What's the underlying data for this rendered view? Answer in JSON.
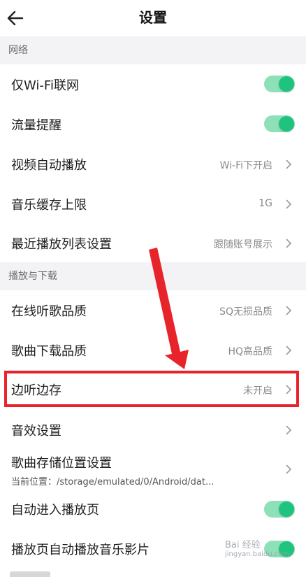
{
  "header": {
    "title": "设置",
    "back_icon": "arrow-left-icon"
  },
  "sections": [
    {
      "title": "网络",
      "items": [
        {
          "label": "仅Wi-Fi联网",
          "control": "toggle",
          "on": true
        },
        {
          "label": "流量提醒",
          "control": "toggle",
          "on": true
        },
        {
          "label": "视频自动播放",
          "value": "Wi-Fi下开启",
          "control": "chevron"
        },
        {
          "label": "音乐缓存上限",
          "value": "1G",
          "control": "chevron"
        },
        {
          "label": "最近播放列表设置",
          "value": "跟随账号展示",
          "control": "chevron"
        }
      ]
    },
    {
      "title": "播放与下载",
      "items": [
        {
          "label": "在线听歌品质",
          "value": "SQ无损品质",
          "control": "chevron"
        },
        {
          "label": "歌曲下载品质",
          "value": "HQ高品质",
          "control": "chevron"
        },
        {
          "label": "边听边存",
          "value": "未开启",
          "control": "chevron"
        },
        {
          "label": "音效设置",
          "control": "chevron"
        },
        {
          "label": "歌曲存储位置设置",
          "sub": "当前位置：/storage/emulated/0/Android/dat...",
          "control": "chevron"
        },
        {
          "label": "自动进入播放页",
          "control": "toggle",
          "on": true
        },
        {
          "label": "播放页自动播放音乐影片",
          "control": "toggle",
          "on": true
        }
      ]
    }
  ],
  "watermark": {
    "text": "Bai 经验",
    "sub": "jingyan.baidu.com"
  },
  "colors": {
    "toggle_on_track": "#8ee0b8",
    "toggle_on_knob": "#1fc37f",
    "annotation_red": "#e8242b",
    "section_bg": "#f3f3f5"
  }
}
